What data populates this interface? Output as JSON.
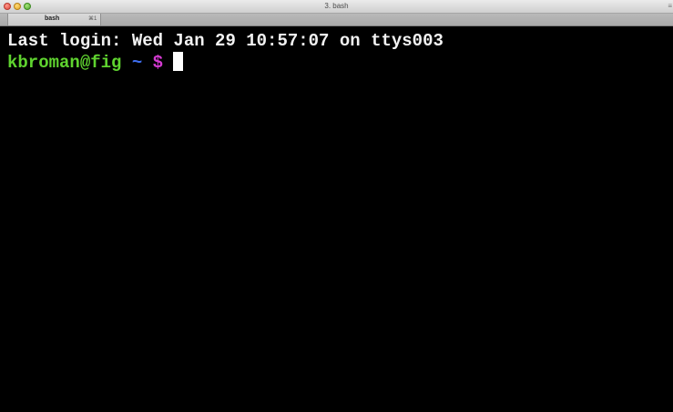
{
  "window": {
    "title": "3. bash",
    "resize_icon": "resize-icon"
  },
  "tabs": [
    {
      "label": "bash",
      "shortcut": "⌘1",
      "active": true
    }
  ],
  "terminal": {
    "last_login": "Last login: Wed Jan 29 10:57:07 on ttys003",
    "prompt": {
      "user_host": "kbroman@fig",
      "cwd": "~",
      "symbol": "$"
    },
    "colors": {
      "background": "#000000",
      "text": "#f2f2f2",
      "user_host": "#5fd32f",
      "cwd": "#3f6ff2",
      "prompt_symbol": "#d33ad0",
      "cursor": "#ffffff"
    }
  }
}
